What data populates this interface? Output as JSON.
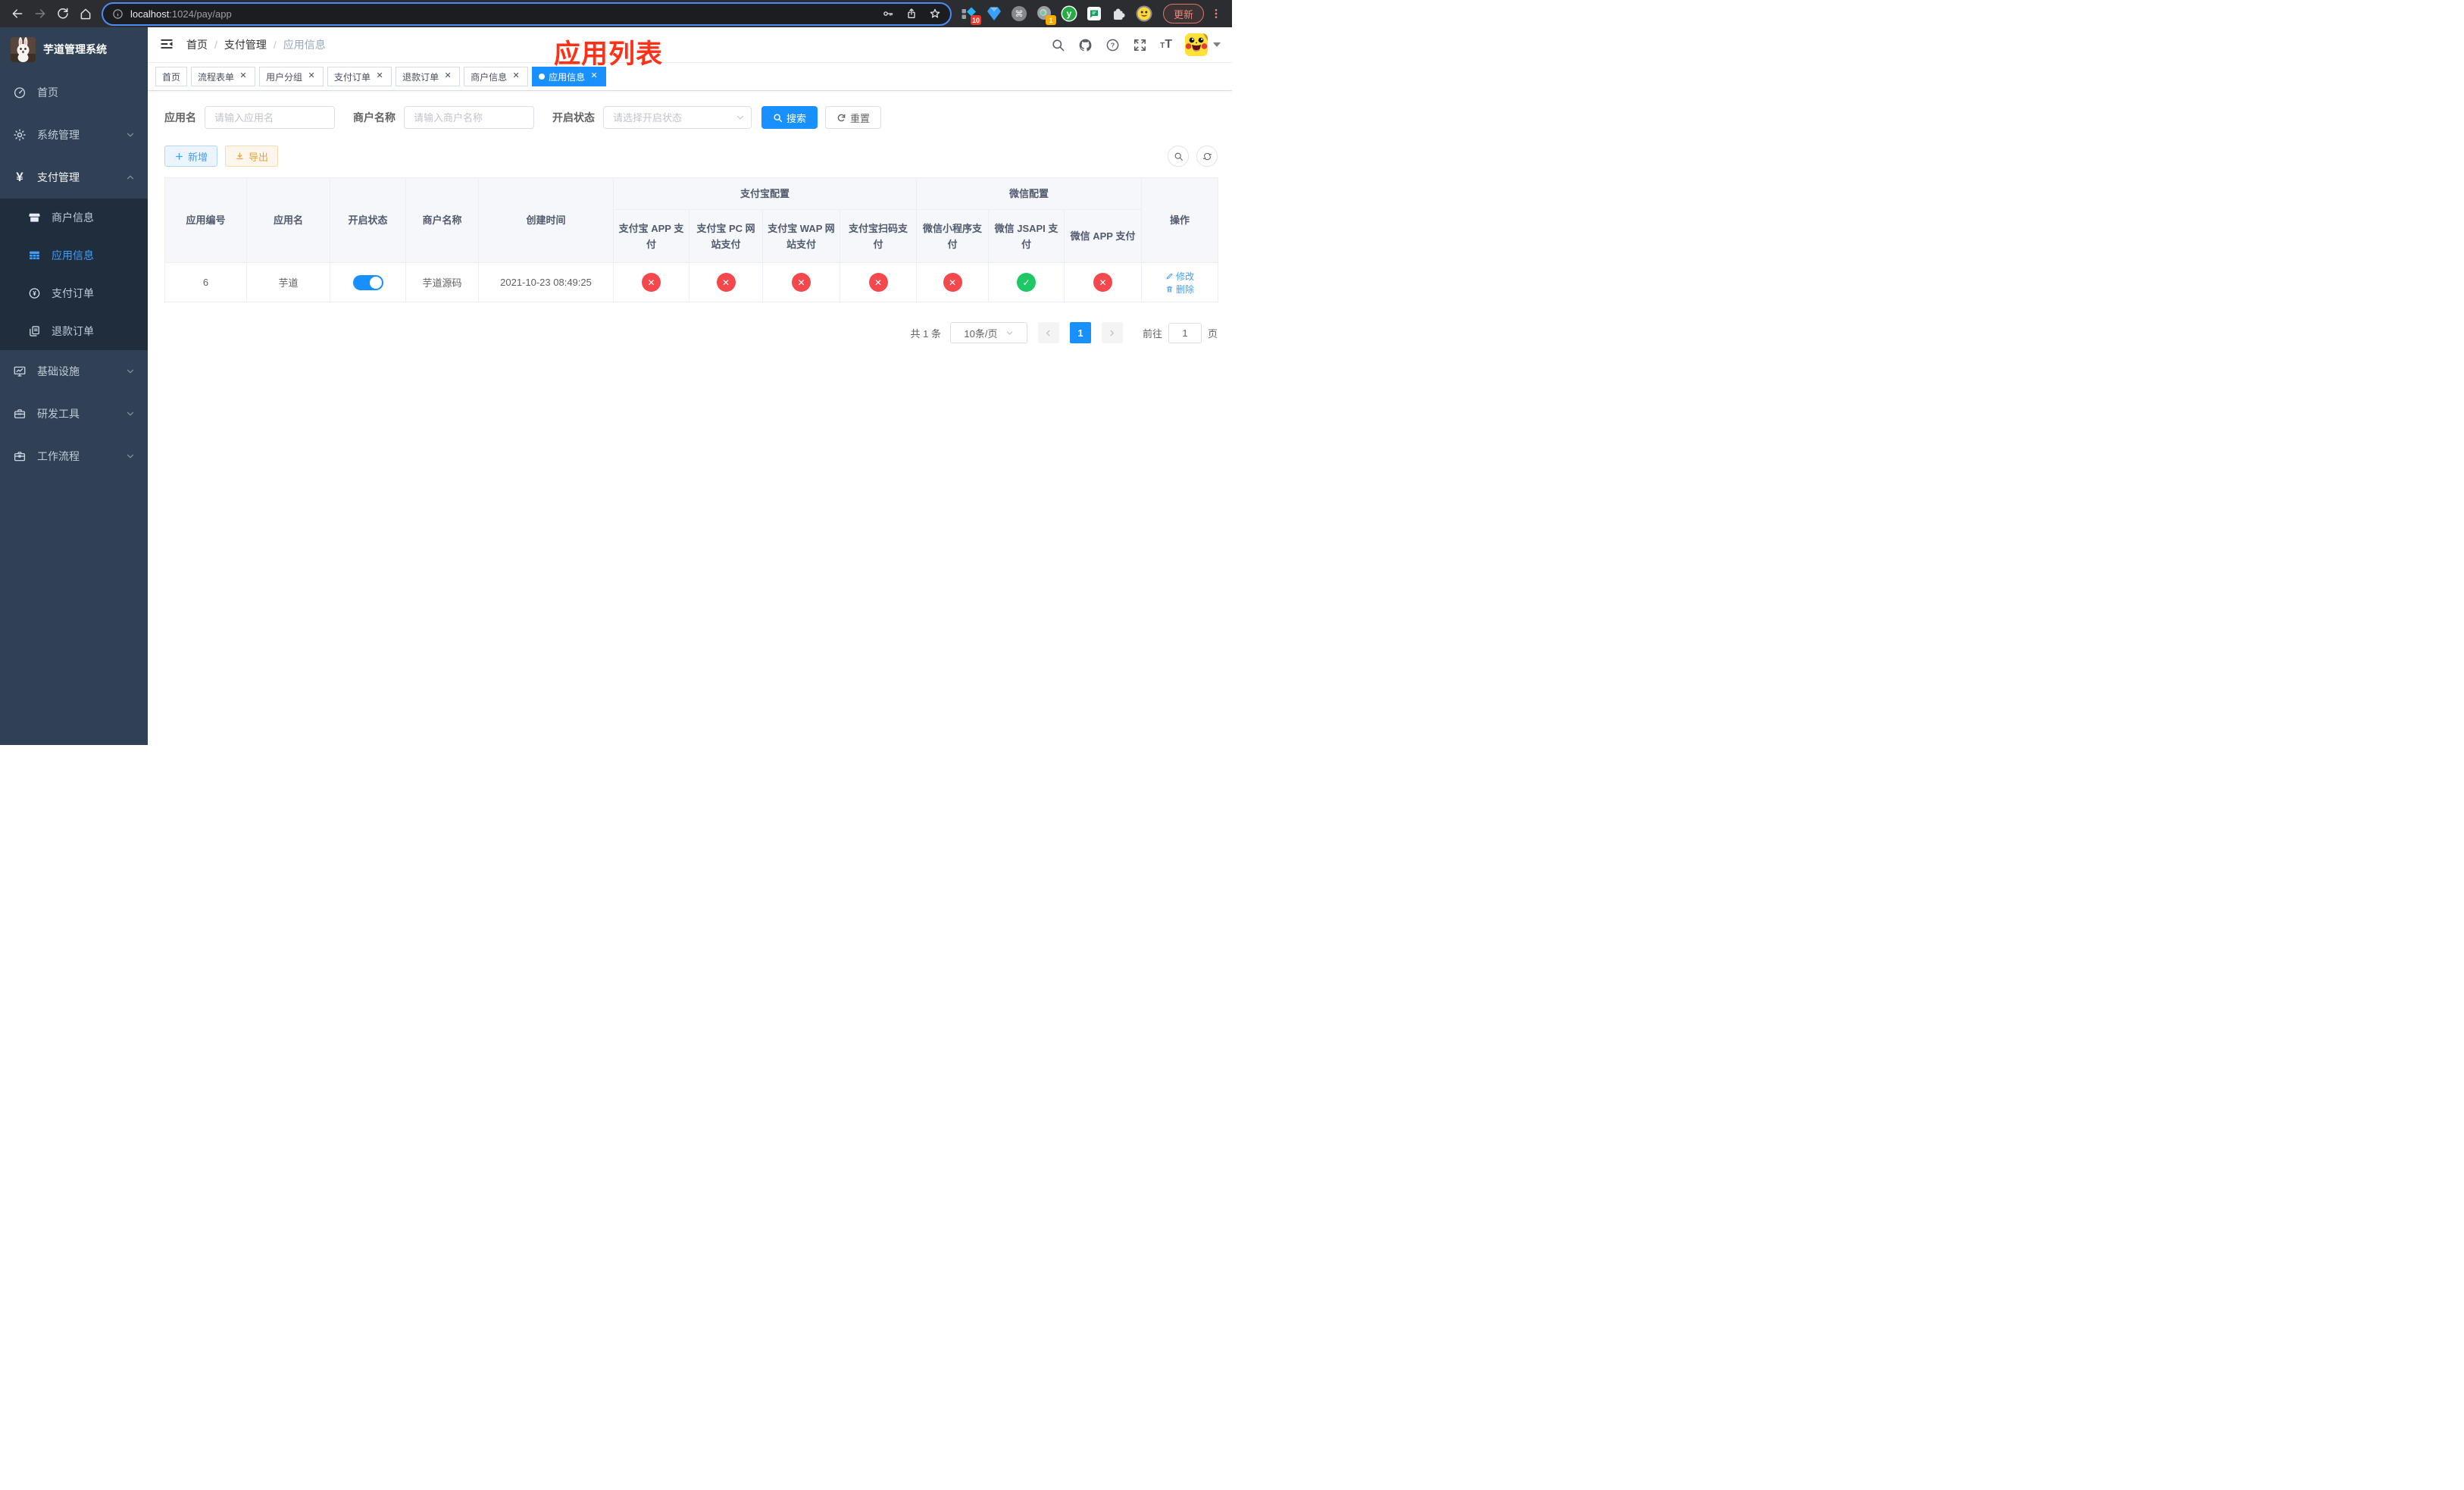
{
  "browser": {
    "url_host": "localhost",
    "url_path": ":1024/pay/app",
    "update_label": "更新",
    "ext_badge_pins": "10",
    "ext_badge_meet": "1",
    "ext_y_letter": "y",
    "ext_cmd_glyph": "⌘"
  },
  "sidebar": {
    "title": "芋道管理系统",
    "menu": [
      {
        "label": "首页"
      },
      {
        "label": "系统管理"
      },
      {
        "label": "支付管理"
      },
      {
        "label": "基础设施"
      },
      {
        "label": "研发工具"
      },
      {
        "label": "工作流程"
      }
    ],
    "submenu": [
      {
        "label": "商户信息"
      },
      {
        "label": "应用信息"
      },
      {
        "label": "支付订单"
      },
      {
        "label": "退款订单"
      }
    ]
  },
  "navbar": {
    "breadcrumb": [
      "首页",
      "支付管理",
      "应用信息"
    ]
  },
  "annotation": "应用列表",
  "tabs": [
    {
      "label": "首页"
    },
    {
      "label": "流程表单"
    },
    {
      "label": "用户分组"
    },
    {
      "label": "支付订单"
    },
    {
      "label": "退款订单"
    },
    {
      "label": "商户信息"
    },
    {
      "label": "应用信息"
    }
  ],
  "filters": {
    "app_name_label": "应用名",
    "app_name_placeholder": "请输入应用名",
    "merchant_label": "商户名称",
    "merchant_placeholder": "请输入商户名称",
    "status_label": "开启状态",
    "status_placeholder": "请选择开启状态",
    "search_label": "搜索",
    "reset_label": "重置"
  },
  "toolbar": {
    "add_label": "新增",
    "export_label": "导出"
  },
  "table": {
    "group_alipay": "支付宝配置",
    "group_wechat": "微信配置",
    "col_id": "应用编号",
    "col_name": "应用名",
    "col_status": "开启状态",
    "col_merchant": "商户名称",
    "col_created": "创建时间",
    "col_actions": "操作",
    "alipay_cols": [
      "支付宝 APP 支付",
      "支付宝 PC 网站支付",
      "支付宝 WAP 网站支付",
      "支付宝扫码支付"
    ],
    "wechat_cols": [
      "微信小程序支付",
      "微信 JSAPI 支付",
      "微信 APP 支付"
    ],
    "rows": [
      {
        "id": "6",
        "name": "芋道",
        "enabled": true,
        "merchant": "芋道源码",
        "created": "2021-10-23 08:49:25",
        "configs": [
          "fail",
          "fail",
          "fail",
          "fail",
          "fail",
          "success",
          "fail"
        ],
        "edit_label": "修改",
        "delete_label": "删除"
      }
    ]
  },
  "pagination": {
    "total": "共 1 条",
    "page_size": "10条/页",
    "page": "1",
    "goto_prefix": "前往",
    "goto_value": "1",
    "goto_suffix": "页"
  },
  "colors": {
    "accent_solid": "#1890ff",
    "accent_link": "#409eff",
    "success": "#1ec864",
    "danger": "#f5484c",
    "warning": "#e6a23c",
    "sidebar_bg": "#304156",
    "submenu_bg": "#1f2d3d",
    "annotation_red": "#ff3018"
  }
}
